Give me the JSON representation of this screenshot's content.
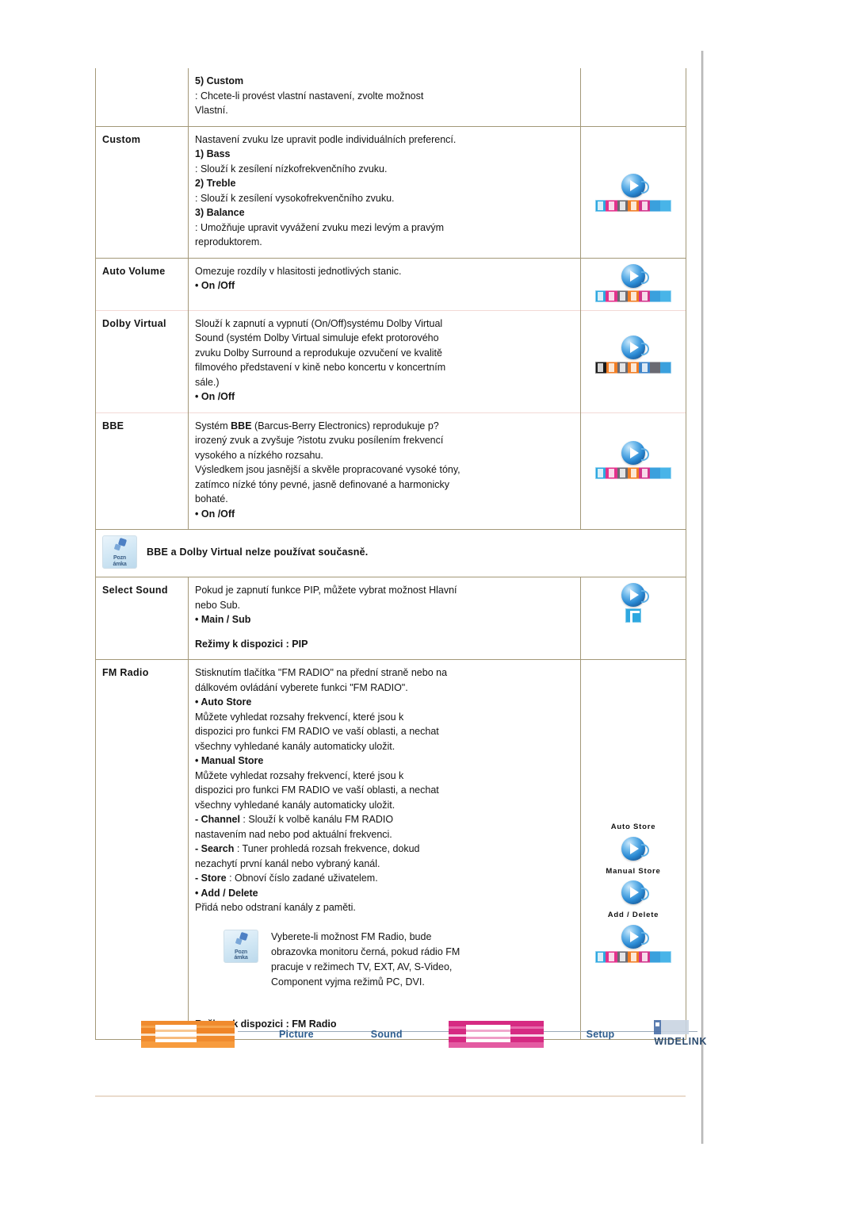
{
  "document": {
    "language": "cs",
    "type": "monitor-manual-sound-settings"
  },
  "table": {
    "rows": [
      {
        "id": "custom-continued",
        "label": "",
        "lines": [
          {
            "style": "bold-indent1",
            "text": "5) Custom"
          },
          {
            "style": "indent2",
            "text": ": Chcete-li provést vlastní nastavení, zvolte možnost"
          },
          {
            "style": "indent2",
            "text": "Vlastní."
          }
        ],
        "icons": []
      },
      {
        "id": "custom",
        "label": "Custom",
        "lines": [
          {
            "style": "plain",
            "text": "Nastavení zvuku lze upravit podle individuálních preferencí."
          },
          {
            "style": "bold-indent1",
            "text": "1) Bass"
          },
          {
            "style": "indent2",
            "text": ": Slouží k zesílení nízkofrekvenčního zvuku."
          },
          {
            "style": "bold-indent1",
            "text": "2) Treble"
          },
          {
            "style": "indent2",
            "text": ": Slouží k zesílení vysokofrekvenčního zvuku."
          },
          {
            "style": "bold-indent1",
            "text": "3) Balance"
          },
          {
            "style": "indent2",
            "text": ": Umožňuje upravit vyvážení zvuku mezi levým a pravým"
          },
          {
            "style": "indent2",
            "text": "reproduktorem."
          }
        ],
        "icons": [
          {
            "type": "orb-tiles",
            "caption": "",
            "variant": "color"
          }
        ]
      },
      {
        "id": "auto-volume",
        "label": "Auto Volume",
        "lines": [
          {
            "style": "plain",
            "text": "Omezuje rozdíly v hlasitosti jednotlivých stanic."
          },
          {
            "style": "bullet",
            "text": "On /Off"
          }
        ],
        "icons": [
          {
            "type": "orb-tiles",
            "caption": "",
            "variant": "color"
          }
        ]
      },
      {
        "id": "dolby-virtual",
        "label": "Dolby Virtual",
        "lines": [
          {
            "style": "plain",
            "text": "Slouží k zapnutí a vypnutí (On/Off)systému Dolby Virtual"
          },
          {
            "style": "plain",
            "text": "Sound (systém Dolby Virtual simuluje efekt protorového"
          },
          {
            "style": "plain",
            "text": "zvuku Dolby Surround a reprodukuje ozvučení ve kvalitě"
          },
          {
            "style": "plain",
            "text": "filmového představení v kině nebo koncertu v koncertním"
          },
          {
            "style": "plain",
            "text": "sále.)"
          },
          {
            "style": "bullet",
            "text": "On /Off"
          }
        ],
        "icons": [
          {
            "type": "orb-tiles",
            "caption": "",
            "variant": "dark"
          }
        ]
      },
      {
        "id": "bbe",
        "label": "BBE",
        "lines": [
          {
            "style": "plain-mixed",
            "text": "Systém BBE (Barcus-Berry Electronics) reprodukuje p?",
            "bold_part": "BBE"
          },
          {
            "style": "plain",
            "text": "irozený zvuk a zvyšuje ?istotu zvuku posílením frekvencí"
          },
          {
            "style": "plain",
            "text": "vysokého a nízkého rozsahu."
          },
          {
            "style": "plain",
            "text": "Výsledkem jsou jasnější a skvěle propracované vysoké tóny,"
          },
          {
            "style": "plain",
            "text": "zatímco nízké tóny pevné, jasně definované a harmonicky"
          },
          {
            "style": "plain",
            "text": "bohaté."
          },
          {
            "style": "bullet",
            "text": "On /Off"
          }
        ],
        "icons": [
          {
            "type": "orb-tiles",
            "caption": "",
            "variant": "color"
          }
        ]
      }
    ],
    "note_row": {
      "id": "note-bbe-dolby",
      "icon_label_line1": "Pozn",
      "icon_label_line2": "ámka",
      "text": "BBE a Dolby Virtual nelze používat současně."
    },
    "select_sound": {
      "id": "select-sound",
      "label": "Select Sound",
      "lines": [
        {
          "style": "plain",
          "text": "Pokud je zapnutí funkce PIP, můžete vybrat možnost Hlavní"
        },
        {
          "style": "plain",
          "text": "nebo Sub."
        },
        {
          "style": "bullet",
          "text": "Main / Sub"
        },
        {
          "style": "gap",
          "text": ""
        },
        {
          "style": "bold-indent1",
          "text": "Režimy k dispozici :  PIP"
        }
      ],
      "icons": [
        {
          "type": "orb-single",
          "caption": ""
        }
      ]
    },
    "fm_radio": {
      "id": "fm-radio",
      "label": "FM Radio",
      "lines": [
        {
          "style": "plain",
          "text": "Stisknutím tlačítka \"FM RADIO\" na přední straně nebo na"
        },
        {
          "style": "plain",
          "text": "dálkovém ovládání vyberete funkci \"FM RADIO\"."
        },
        {
          "style": "bullet",
          "text": "Auto Store"
        },
        {
          "style": "indent2",
          "text": "Můžete vyhledat rozsahy frekvencí, které jsou k"
        },
        {
          "style": "indent2",
          "text": "dispozici pro funkci FM RADIO ve vaší oblasti, a nechat"
        },
        {
          "style": "indent2",
          "text": "všechny vyhledané kanály automaticky uložit."
        },
        {
          "style": "bullet",
          "text": "Manual Store"
        },
        {
          "style": "indent2",
          "text": "Můžete vyhledat rozsahy frekvencí, které jsou k"
        },
        {
          "style": "indent2",
          "text": "dispozici pro funkci FM RADIO ve vaší oblasti, a nechat"
        },
        {
          "style": "indent2",
          "text": "všechny vyhledané kanály automaticky uložit."
        },
        {
          "style": "indent3-mixed",
          "text": "- Channel : Slouží k volbě kanálu FM RADIO",
          "bold_part": "- Channel"
        },
        {
          "style": "indent2-flush",
          "text": "nastavením nad nebo pod aktuální frekvenci."
        },
        {
          "style": "indent3-mixed",
          "text": "- Search : Tuner prohledá rozsah frekvence, dokud",
          "bold_part": "- Search"
        },
        {
          "style": "indent2-flush",
          "text": "nezachytí první kanál nebo vybraný kanál."
        },
        {
          "style": "indent3-mixed",
          "text": "- Store : Obnoví číslo zadané uživatelem.",
          "bold_part": "- Store"
        },
        {
          "style": "bullet",
          "text": "Add / Delete"
        },
        {
          "style": "indent2",
          "text": "Přidá nebo odstraní kanály z paměti."
        }
      ],
      "inner_note": {
        "icon_label_line1": "Pozn",
        "icon_label_line2": "ámka",
        "lines": [
          "Vyberete-li možnost FM Radio, bude",
          "obrazovka monitoru černá, pokud rádio FM",
          "pracuje v režimech TV, EXT, AV, S-Video,",
          "Component vyjma režimů PC, DVI."
        ]
      },
      "footer_line": "Režimy k dispozici :  FM Radio",
      "icons": [
        {
          "type": "orb",
          "caption": "Auto Store"
        },
        {
          "type": "orb",
          "caption": "Manual Store"
        },
        {
          "type": "orb-tiles",
          "caption": "Add / Delete",
          "variant": "color"
        }
      ]
    }
  },
  "footer_nav": {
    "items": [
      {
        "id": "nav-block-orange",
        "kind": "highlight-block",
        "label": "",
        "color": "#f08b2e"
      },
      {
        "id": "nav-picture",
        "kind": "link",
        "label": "Picture"
      },
      {
        "id": "nav-sound",
        "kind": "link",
        "label": "Sound"
      },
      {
        "id": "nav-block-pink",
        "kind": "highlight-block",
        "label": "",
        "color": "#d62a82"
      },
      {
        "id": "nav-setup",
        "kind": "link",
        "label": "Setup"
      },
      {
        "id": "nav-widelink",
        "kind": "brand",
        "label": "WIDELINK"
      }
    ]
  },
  "colors": {
    "table_border": "#a39878",
    "soft_divider": "#f3d9d6",
    "bottom_rule": "#eadbcd",
    "nav_link": "#2d5d8e",
    "nav_line": "#9aa9b8"
  }
}
